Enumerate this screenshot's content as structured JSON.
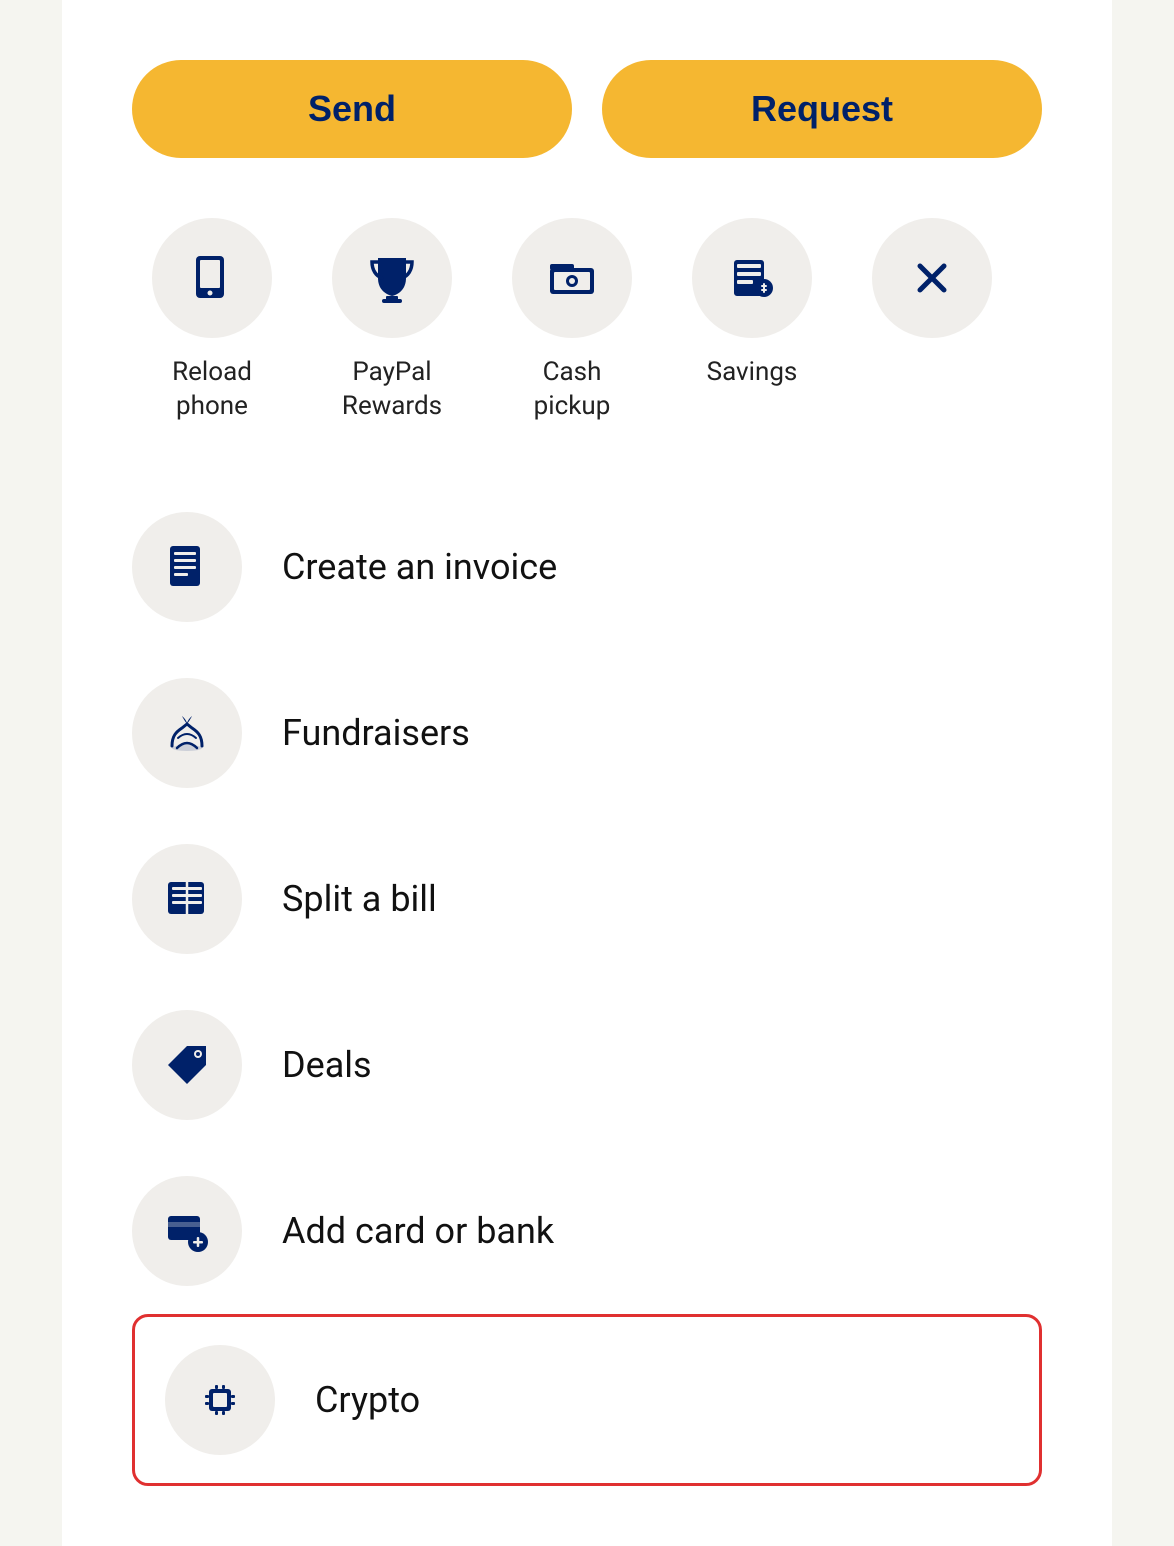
{
  "buttons": {
    "send": "Send",
    "request": "Request"
  },
  "quickActions": [
    {
      "id": "reload-phone",
      "label": "Reload\nphone",
      "icon": "reload-phone-icon"
    },
    {
      "id": "paypal-rewards",
      "label": "PayPal\nRewards",
      "icon": "trophy-icon"
    },
    {
      "id": "cash-pickup",
      "label": "Cash\npickup",
      "icon": "cash-pickup-icon"
    },
    {
      "id": "savings",
      "label": "Savings",
      "icon": "savings-icon"
    },
    {
      "id": "close",
      "label": "",
      "icon": "close-icon"
    }
  ],
  "listItems": [
    {
      "id": "create-invoice",
      "label": "Create an invoice",
      "icon": "invoice-icon",
      "highlighted": false
    },
    {
      "id": "fundraisers",
      "label": "Fundraisers",
      "icon": "fundraisers-icon",
      "highlighted": false
    },
    {
      "id": "split-bill",
      "label": "Split a bill",
      "icon": "split-bill-icon",
      "highlighted": false
    },
    {
      "id": "deals",
      "label": "Deals",
      "icon": "deals-icon",
      "highlighted": false
    },
    {
      "id": "add-card-bank",
      "label": "Add card or bank",
      "icon": "add-card-icon",
      "highlighted": false
    },
    {
      "id": "crypto",
      "label": "Crypto",
      "icon": "crypto-icon",
      "highlighted": true
    }
  ]
}
